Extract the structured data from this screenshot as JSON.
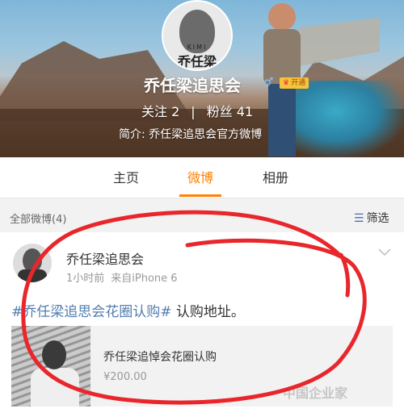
{
  "profile": {
    "name": "乔任梁追思会",
    "gender_symbol": "♂",
    "vip_label": "开通",
    "avatar_text": "KIMI",
    "avatar_mark": "乔任梁",
    "following_label": "关注",
    "following_count": "2",
    "separator": "|",
    "followers_label": "粉丝",
    "followers_count": "41",
    "bio": "简介: 乔任梁追思会官方微博"
  },
  "tabs": [
    {
      "label": "主页"
    },
    {
      "label": "微博",
      "active": true
    },
    {
      "label": "相册"
    }
  ],
  "filter": {
    "count_label": "全部微博(4)",
    "button_label": "筛选",
    "button_icon": "filter-icon"
  },
  "post": {
    "author": "乔任梁追思会",
    "time": "1小时前",
    "source": "来自iPhone 6",
    "hashtag": "#乔任梁追思会花圈认购#",
    "text": " 认购地址。",
    "attachment": {
      "title": "乔任梁追悼会花圈认购",
      "price": "¥200.00"
    }
  },
  "watermark": "中国企业家",
  "colors": {
    "accent": "#ff8200",
    "link": "#507daf",
    "annotation": "#e8262b"
  }
}
